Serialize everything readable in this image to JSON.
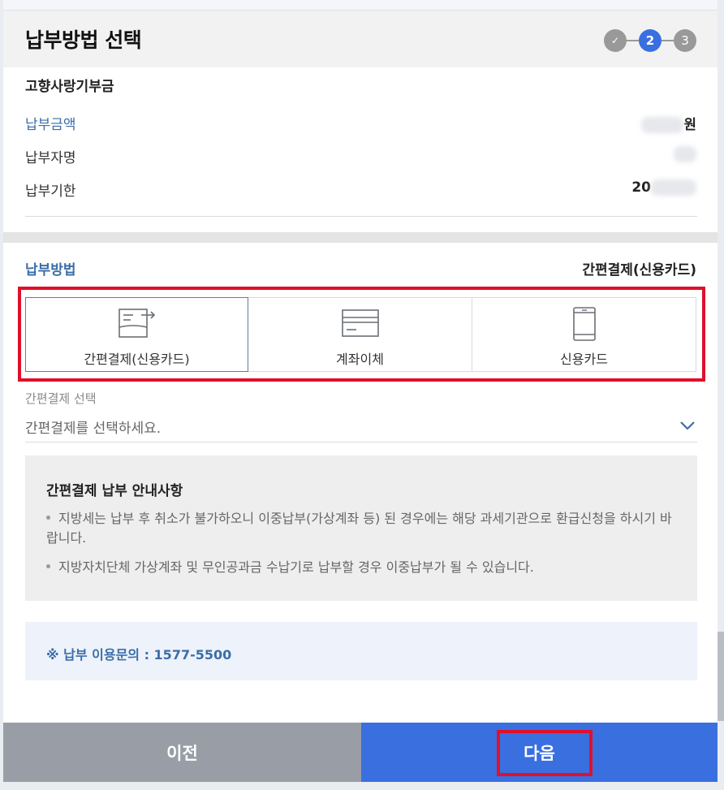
{
  "header": {
    "title": "납부방법 선택",
    "steps": [
      {
        "label": "✓",
        "state": "done"
      },
      {
        "label": "2",
        "state": "current"
      },
      {
        "label": "3",
        "state": "todo"
      }
    ]
  },
  "summary": {
    "section_title": "고향사랑기부금",
    "rows": [
      {
        "label": "납부금액",
        "value_suffix": "원"
      },
      {
        "label": "납부자명",
        "value_suffix": ""
      },
      {
        "label": "납부기한",
        "value_prefix": "20"
      }
    ]
  },
  "payment": {
    "label": "납부방법",
    "selected_value": "간편결제(신용카드)",
    "options": [
      {
        "label": "간편결제(신용카드)",
        "icon": "simple-pay-icon",
        "selected": true
      },
      {
        "label": "계좌이체",
        "icon": "bank-card-icon",
        "selected": false
      },
      {
        "label": "신용카드",
        "icon": "phone-card-icon",
        "selected": false
      }
    ]
  },
  "simple_pay_select": {
    "caption": "간편결제 선택",
    "placeholder": "간편결제를 선택하세요."
  },
  "notice": {
    "title": "간편결제 납부 안내사항",
    "items": [
      "지방세는 납부 후 취소가 불가하오니 이중납부(가상계좌 등) 된 경우에는 해당 과세기관으로 환급신청을 하시기 바랍니다.",
      "지방자치단체 가상계좌 및 무인공과금 수납기로 납부할 경우 이중납부가 될 수 있습니다."
    ]
  },
  "contact": {
    "text": "※ 납부 이용문의 : 1577-5500"
  },
  "footer": {
    "prev_label": "이전",
    "next_label": "다음"
  },
  "colors": {
    "primary": "#3a6fe0",
    "label_blue": "#3b6ea8",
    "highlight_red": "#e0102a",
    "prev_gray": "#999ea6"
  }
}
